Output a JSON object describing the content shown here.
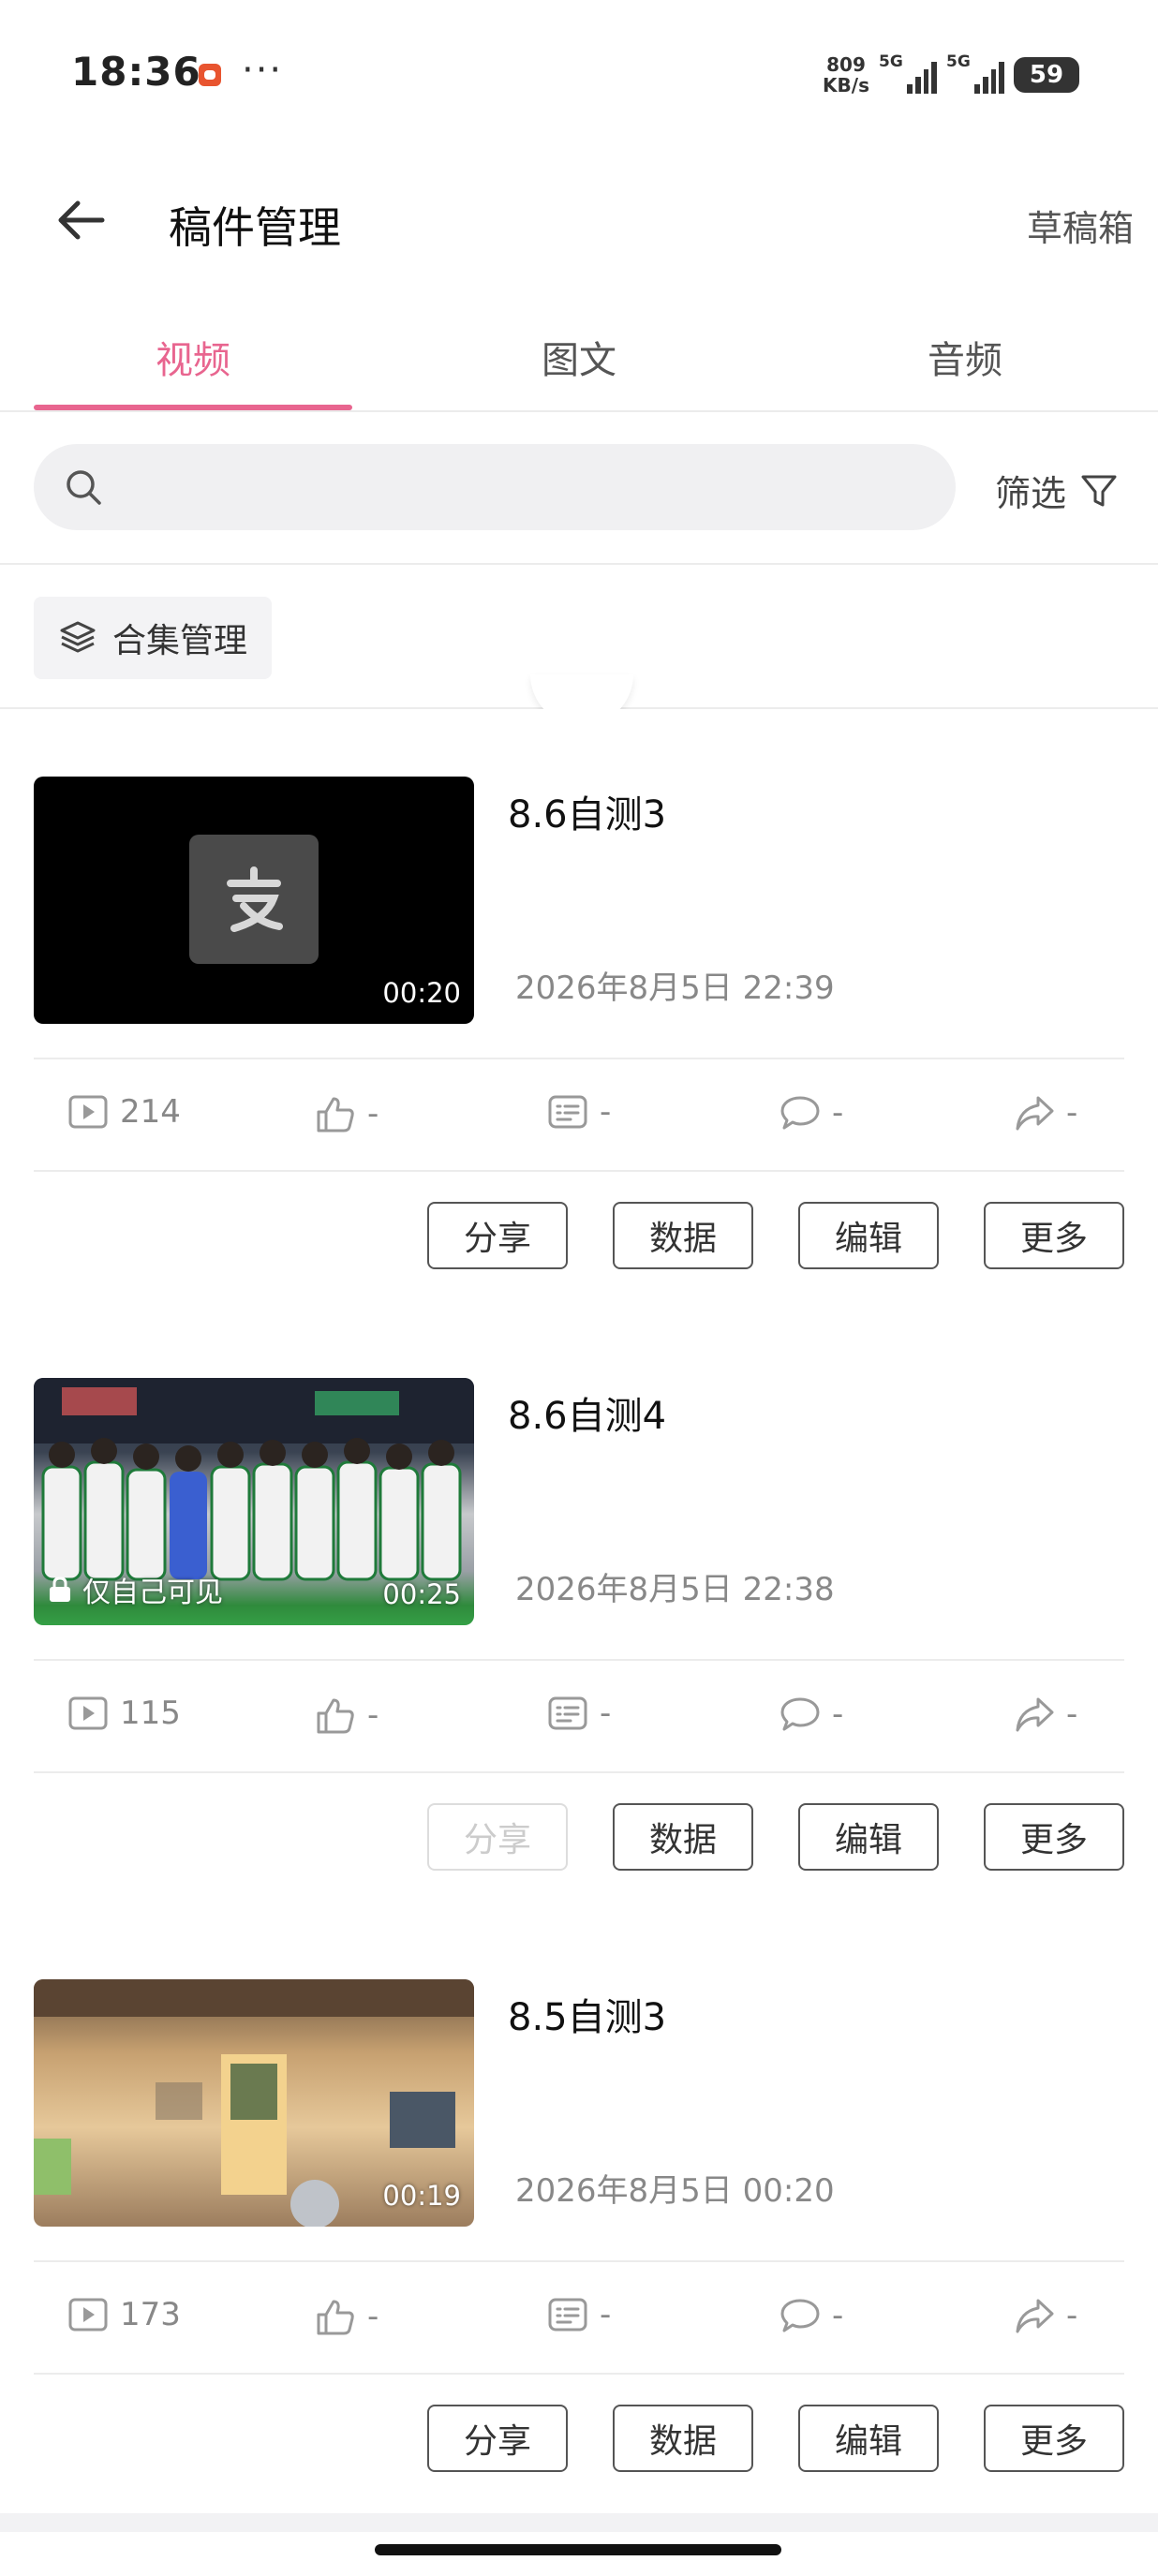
{
  "status_bar": {
    "time": "18:36",
    "dots": "···",
    "net_speed_value": "809",
    "net_speed_unit": "KB/s",
    "signal_1": "5G",
    "signal_2": "5G",
    "battery": "59"
  },
  "header": {
    "title": "稿件管理",
    "drafts": "草稿箱"
  },
  "tabs": [
    {
      "label": "视频",
      "active": true
    },
    {
      "label": "图文",
      "active": false
    },
    {
      "label": "音频",
      "active": false
    }
  ],
  "search": {
    "placeholder": "",
    "filter_label": "筛选"
  },
  "collection": {
    "label": "合集管理"
  },
  "accent_color": "#e8658f",
  "videos": [
    {
      "title": "8.6自测3",
      "date": "2026年8月5日 22:39",
      "duration": "00:20",
      "private_label": "",
      "views": "214",
      "likes": "-",
      "danmaku": "-",
      "comments": "-",
      "shares": "-",
      "actions": {
        "share": "分享",
        "data": "数据",
        "edit": "编辑",
        "more": "更多"
      },
      "share_disabled": false
    },
    {
      "title": "8.6自测4",
      "date": "2026年8月5日 22:38",
      "duration": "00:25",
      "private_label": "仅自己可见",
      "views": "115",
      "likes": "-",
      "danmaku": "-",
      "comments": "-",
      "shares": "-",
      "actions": {
        "share": "分享",
        "data": "数据",
        "edit": "编辑",
        "more": "更多"
      },
      "share_disabled": true
    },
    {
      "title": "8.5自测3",
      "date": "2026年8月5日 00:20",
      "duration": "00:19",
      "private_label": "",
      "views": "173",
      "likes": "-",
      "danmaku": "-",
      "comments": "-",
      "shares": "-",
      "actions": {
        "share": "分享",
        "data": "数据",
        "edit": "编辑",
        "more": "更多"
      },
      "share_disabled": false
    }
  ]
}
